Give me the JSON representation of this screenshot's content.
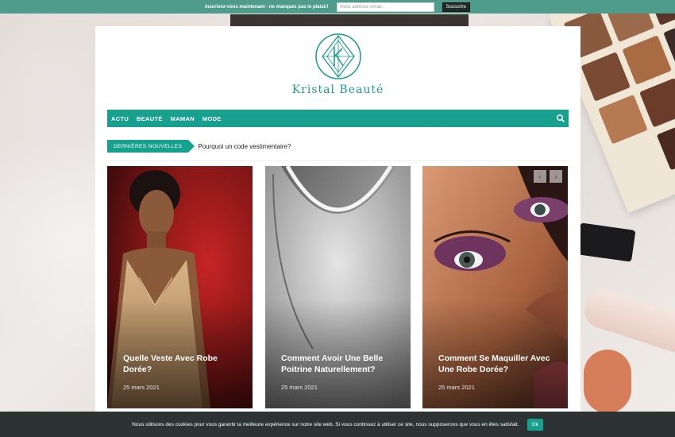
{
  "topbar": {
    "text": "Inscrivez-vous maintenant - ne manquez pas le plaisir!",
    "email_placeholder": "Votre adresse email...",
    "subscribe_label": "Souscrire"
  },
  "header": {
    "logo_text": "Kristal Beauté",
    "brand_color": "#17a08e"
  },
  "nav": {
    "items": [
      {
        "label": "ACTU"
      },
      {
        "label": "BEAUTÉ"
      },
      {
        "label": "MAMAN"
      },
      {
        "label": "MODE"
      }
    ],
    "search_icon": "search-icon"
  },
  "news": {
    "label": "DERNIÈRES NOUVELLES",
    "headline": "Pourquoi un code vestimentaire?"
  },
  "slider": {
    "prev_icon": "chevron-left-icon",
    "next_icon": "chevron-right-icon",
    "prev_label": "‹",
    "next_label": "›",
    "cards": [
      {
        "title": "Quelle Veste Avec Robe Dorée?",
        "date": "25 mars 2021"
      },
      {
        "title": "Comment Avoir Une Belle Poitrine Naturellement?",
        "date": "25 mars 2021"
      },
      {
        "title": "Comment Se Maquiller Avec Une Robe Dorée?",
        "date": "25 mars 2021"
      }
    ]
  },
  "cookie": {
    "text": "Nous utilisons des cookies pour vous garantir la meilleure expérience sur notre site web. Si vous continuez à utiliser ce site, nous supposerons que vous en êtes satisfait.",
    "ok_label": "Ok"
  }
}
